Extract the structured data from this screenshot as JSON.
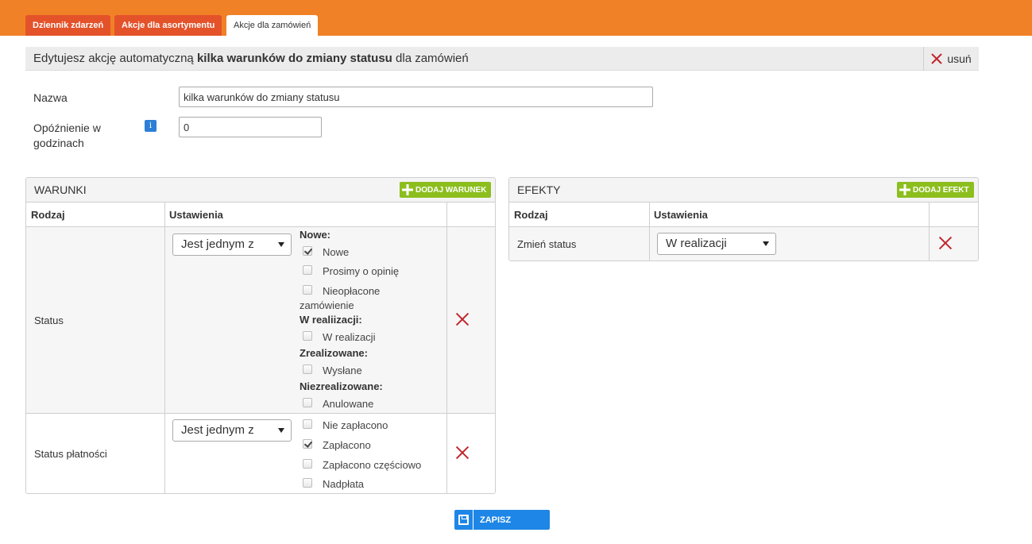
{
  "tabs": [
    {
      "label": "Dziennik zdarzeń",
      "active": false
    },
    {
      "label": "Akcje dla asortymentu",
      "active": false
    },
    {
      "label": "Akcje dla zamówień",
      "active": true
    }
  ],
  "header": {
    "prefix": "Edytujesz akcję automatyczną",
    "action_name": "kilka warunków do zmiany statusu",
    "suffix": "dla zamówień",
    "delete_label": "usuń"
  },
  "form": {
    "name_label": "Nazwa",
    "name_value": "kilka warunków do zmiany statusu",
    "delay_label": "Opóźnienie w godzinach",
    "delay_value": "0",
    "info_icon": "i"
  },
  "conditions": {
    "title": "WARUNKI",
    "add_label": "DODAJ WARUNEK",
    "col_type": "Rodzaj",
    "col_settings": "Ustawienia",
    "rows": [
      {
        "type": "Status",
        "operator": "Jest jednym z",
        "groups": [
          {
            "name": "Nowe:",
            "options": [
              {
                "label": "Nowe",
                "checked": true
              },
              {
                "label": "Prosimy o opinię",
                "checked": false
              },
              {
                "label": "Nieopłacone zamówienie",
                "checked": false
              }
            ]
          },
          {
            "name": "W realiizacji:",
            "options": [
              {
                "label": "W realizacji",
                "checked": false
              }
            ]
          },
          {
            "name": "Zrealizowane:",
            "options": [
              {
                "label": "Wysłane",
                "checked": false
              }
            ]
          },
          {
            "name": "Niezrealizowane:",
            "options": [
              {
                "label": "Anulowane",
                "checked": false
              }
            ]
          }
        ]
      },
      {
        "type": "Status płatności",
        "operator": "Jest jednym z",
        "options": [
          {
            "label": "Nie zapłacono",
            "checked": false
          },
          {
            "label": "Zapłacono",
            "checked": true
          },
          {
            "label": "Zapłacono częściowo",
            "checked": false
          },
          {
            "label": "Nadpłata",
            "checked": false
          }
        ]
      }
    ]
  },
  "effects": {
    "title": "EFEKTY",
    "add_label": "DODAJ EFEKT",
    "col_type": "Rodzaj",
    "col_settings": "Ustawienia",
    "rows": [
      {
        "type": "Zmień status",
        "value": "W realizacji"
      }
    ]
  },
  "save_label": "ZAPISZ",
  "colors": {
    "topbar": "#f08127",
    "tab_inactive": "#e4522a",
    "add_button": "#8cbe1e",
    "save_button": "#1e86e6",
    "remove": "#c0262c"
  }
}
